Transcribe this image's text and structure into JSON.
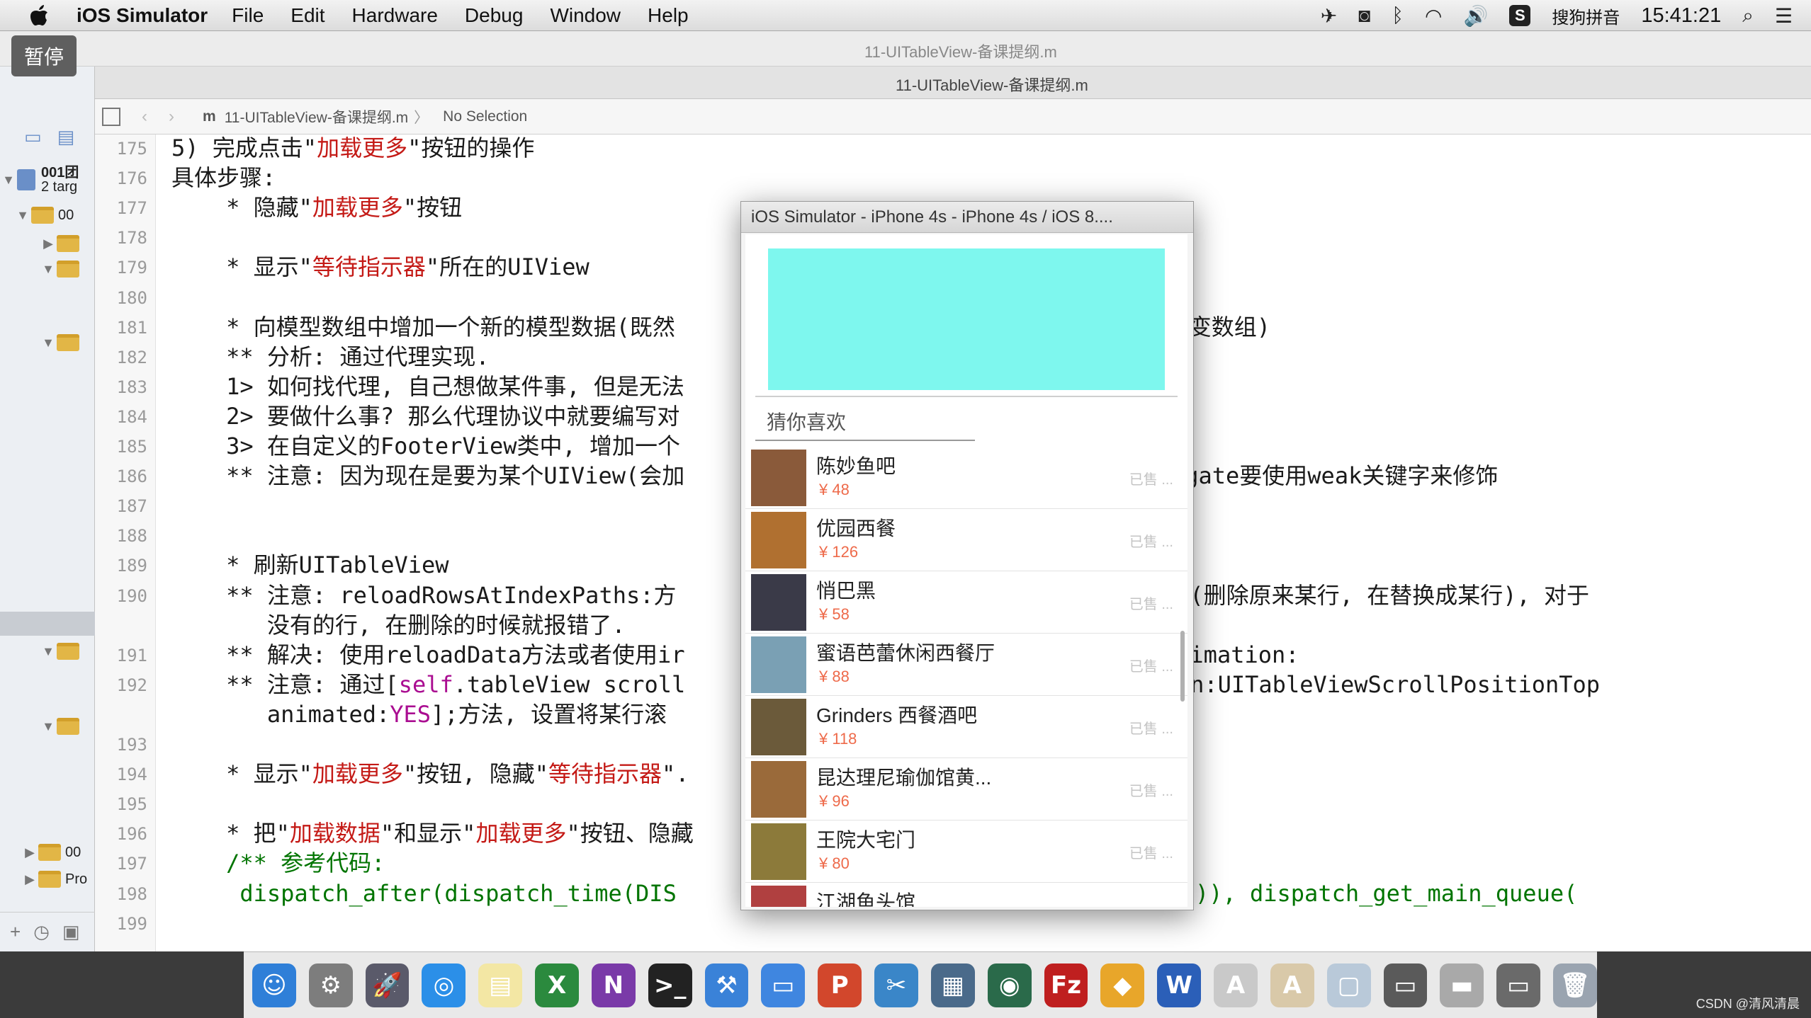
{
  "menubar": {
    "app_name": "iOS Simulator",
    "menus": [
      "File",
      "Edit",
      "Hardware",
      "Debug",
      "Window",
      "Help"
    ],
    "ime_label": "搜狗拼音",
    "clock": "15:41:21"
  },
  "pause_button": "暂停",
  "window": {
    "title": "11-UITableView-备课提纲.m",
    "tab_title": "11-UITableView-备课提纲.m"
  },
  "jumpbar": {
    "file": "11-UITableView-备课提纲.m",
    "selection": "No Selection"
  },
  "navigator": {
    "project_name": "001团",
    "project_sub": "2 targ",
    "rows": [
      "00",
      "00",
      "Pro"
    ]
  },
  "editor": {
    "line_numbers": [
      "175",
      "176",
      "177",
      "178",
      "179",
      "180",
      "181",
      "182",
      "183",
      "184",
      "185",
      "186",
      "187",
      "188",
      "189",
      "190",
      "",
      "191",
      "192",
      "",
      "193",
      "194",
      "195",
      "196",
      "197",
      "198",
      "199"
    ],
    "lines": [
      [
        {
          "t": "5) 完成点击\""
        },
        {
          "t": "加载更多",
          "c": "red"
        },
        {
          "t": "\"按钮的操作"
        }
      ],
      [
        {
          "t": "具体步骤:"
        }
      ],
      [
        {
          "t": "    * 隐藏\""
        },
        {
          "t": "加载更多",
          "c": "red"
        },
        {
          "t": "\"按钮"
        }
      ],
      [
        {
          "t": ""
        }
      ],
      [
        {
          "t": "    * 显示\""
        },
        {
          "t": "等待指示器",
          "c": "red"
        },
        {
          "t": "\"所在的UIView"
        }
      ],
      [
        {
          "t": ""
        }
      ],
      [
        {
          "t": "    * 向模型数组中增加一个新的模型数据(既然                          数组需要使用可变数组)"
        }
      ],
      [
        {
          "t": "    ** 分析: 通过代理实现."
        }
      ],
      [
        {
          "t": "    1> 如何找代理, 自己想做某件事, 但是无法                          代理。",
          "c": ""
        }
      ],
      [
        {
          "t": "    2> 要做什么事? 那么代理协议中就要编写对"
        }
      ],
      [
        {
          "t": "    3> 在自定义的FooterView类中, 增加一个"
        }
      ],
      [
        {
          "t": "    ** 注意: 因为现在是要为某个UIView(会加                          代理属性delegate要使用weak关键字来修饰"
        }
      ],
      [
        {
          "t": ""
        }
      ],
      [
        {
          "t": ""
        }
      ],
      [
        {
          "t": "    * 刷新UITableView"
        }
      ],
      [
        {
          "t": "    ** 注意: reloadRowsAtIndexPaths:方                          情况下刷新数据(删除原来某行, 在替换成某行), 对于"
        }
      ],
      [
        {
          "t": "       没有的行, 在删除的时候就报错了."
        }
      ],
      [
        {
          "t": "    ** 解决: 使用reloadData方法或者使用ir                          ] withRowAnimation:"
        }
      ],
      [
        {
          "t": "    ** 注意: 通过["
        },
        {
          "t": "self",
          "c": "purple"
        },
        {
          "t": ".tableView scroll                          rollPosition:UITableViewScrollPositionTop"
        }
      ],
      [
        {
          "t": "       animated:"
        },
        {
          "t": "YES",
          "c": "purple"
        },
        {
          "t": "];方法, 设置将某行滚"
        }
      ],
      [
        {
          "t": ""
        }
      ],
      [
        {
          "t": "    * 显示\""
        },
        {
          "t": "加载更多",
          "c": "red"
        },
        {
          "t": "\"按钮, 隐藏\""
        },
        {
          "t": "等待指示器",
          "c": "red"
        },
        {
          "t": "\"."
        }
      ],
      [
        {
          "t": ""
        }
      ],
      [
        {
          "t": "    * 把\""
        },
        {
          "t": "加载数据",
          "c": "red"
        },
        {
          "t": "\"和显示\""
        },
        {
          "t": "加载更多",
          "c": "red"
        },
        {
          "t": "\"按钮、隐藏                          方法中执行"
        }
      ],
      [
        {
          "t": "    /** 参考代码:",
          "c": "green"
        }
      ],
      [
        {
          "t": "     dispatch_after(dispatch_time(DIS",
          "c": "green"
        },
        {
          "t": "                          NSEC_PER_SEC)), dispatch_get_main_queue(",
          "c": "green"
        }
      ],
      [
        {
          "t": ""
        }
      ]
    ]
  },
  "simulator": {
    "title": "iOS Simulator - iPhone 4s - iPhone 4s / iOS 8....",
    "section_title": "猜你喜欢",
    "cells": [
      {
        "name": "陈妙鱼吧",
        "price": "¥ 48",
        "buy": "已售 ..."
      },
      {
        "name": "优园西餐",
        "price": "¥ 126",
        "buy": "已售 ..."
      },
      {
        "name": "悄巴黑",
        "price": "¥ 58",
        "buy": "已售 ..."
      },
      {
        "name": "蜜语芭蕾休闲西餐厅",
        "price": "¥ 88",
        "buy": "已售 ..."
      },
      {
        "name": "Grinders 西餐酒吧",
        "price": "¥ 118",
        "buy": "已售 ..."
      },
      {
        "name": "昆达理尼瑜伽馆黄...",
        "price": "¥ 96",
        "buy": "已售 ..."
      },
      {
        "name": "王院大宅门",
        "price": "¥ 80",
        "buy": "已售 ..."
      },
      {
        "name": "江湖鱼头馆",
        "price": "",
        "buy": ""
      }
    ],
    "thumb_colors": [
      "#8a5a3a",
      "#b07030",
      "#3a3a48",
      "#7aa0b4",
      "#6b5a3a",
      "#9a6a3a",
      "#8c7a3a",
      "#b04040"
    ]
  },
  "dock": {
    "icons": [
      {
        "name": "finder-icon",
        "glyph": "☺",
        "color": "#2f7fd8"
      },
      {
        "name": "system-preferences-icon",
        "glyph": "⚙",
        "color": "#7d7d7d"
      },
      {
        "name": "launchpad-icon",
        "glyph": "🚀",
        "color": "#5a5a6a"
      },
      {
        "name": "safari-icon",
        "glyph": "◎",
        "color": "#2b8fe8"
      },
      {
        "name": "notes-icon",
        "glyph": "▤",
        "color": "#f3e7a4"
      },
      {
        "name": "excel-icon",
        "glyph": "X",
        "color": "#2b8a3e"
      },
      {
        "name": "onenote-icon",
        "glyph": "N",
        "color": "#7a3aa8"
      },
      {
        "name": "terminal-icon",
        "glyph": ">_",
        "color": "#222"
      },
      {
        "name": "xcode-icon",
        "glyph": "⚒",
        "color": "#3a82d8"
      },
      {
        "name": "folder-icon",
        "glyph": "▭",
        "color": "#3f86e0"
      },
      {
        "name": "powerpoint-icon",
        "glyph": "P",
        "color": "#d2472c"
      },
      {
        "name": "snipping-tool-icon",
        "glyph": "✂",
        "color": "#3a86c8"
      },
      {
        "name": "simulator-icon",
        "glyph": "▦",
        "color": "#4a6a8a"
      },
      {
        "name": "network-icon",
        "glyph": "◉",
        "color": "#2a6a4a"
      },
      {
        "name": "filezilla-icon",
        "glyph": "Fz",
        "color": "#bf1f1f"
      },
      {
        "name": "sketch-icon",
        "glyph": "◆",
        "color": "#e8a62a"
      },
      {
        "name": "word-icon",
        "glyph": "W",
        "color": "#2b5fb8"
      },
      {
        "name": "font-book-icon",
        "glyph": "A",
        "color": "#c9c9c9"
      },
      {
        "name": "textedit-icon",
        "glyph": "A",
        "color": "#d9c9a9"
      },
      {
        "name": "preview-icon",
        "glyph": "▢",
        "color": "#b9c9d9"
      },
      {
        "name": "screen-sharing-icon",
        "glyph": "▭",
        "color": "#5a5a5a"
      },
      {
        "name": "disk-icon",
        "glyph": "▬",
        "color": "#a9a9a9"
      },
      {
        "name": "remote-desktop-icon",
        "glyph": "▭",
        "color": "#6a6a6a"
      },
      {
        "name": "trash-icon",
        "glyph": "🗑",
        "color": "#9aa4b0"
      }
    ]
  },
  "watermark": "CSDN @清风清晨"
}
